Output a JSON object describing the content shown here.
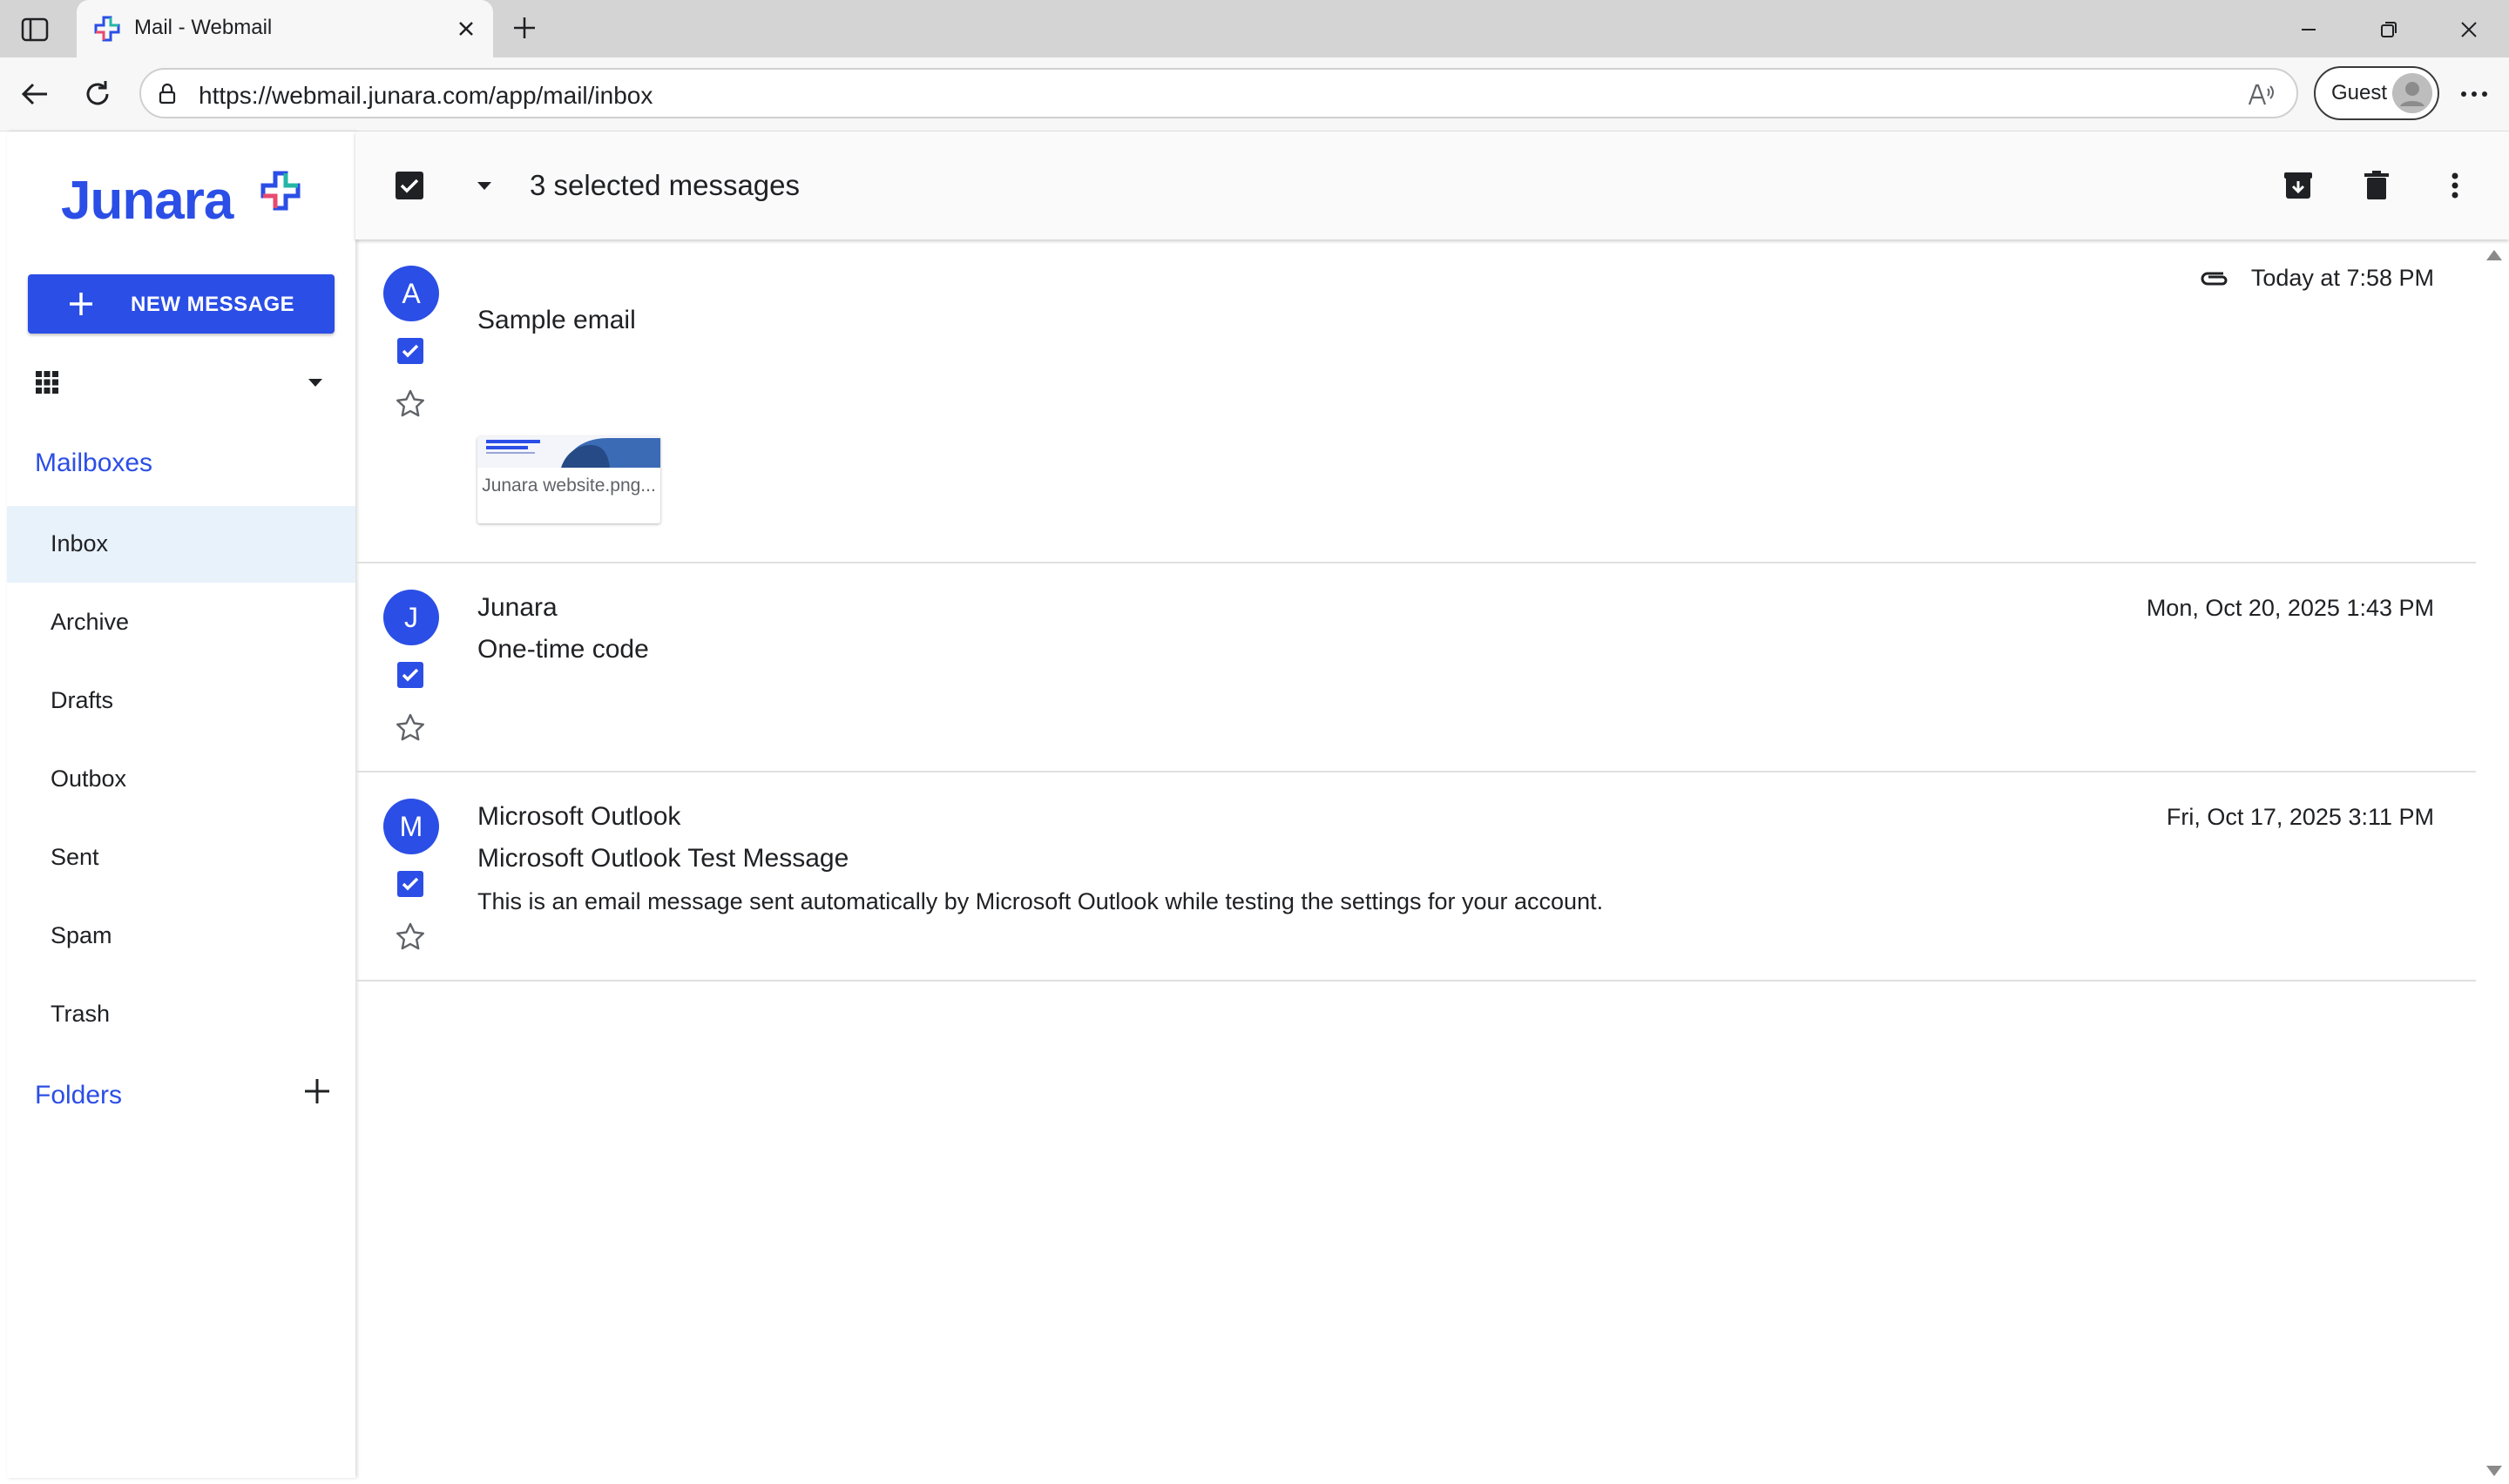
{
  "browser": {
    "tab_title": "Mail - Webmail",
    "url": "https://webmail.junara.com/app/mail/inbox",
    "profile_label": "Guest"
  },
  "app": {
    "logo_text": "Junara",
    "new_message_label": "NEW MESSAGE",
    "mailboxes_title": "Mailboxes",
    "mailboxes": [
      {
        "label": "Inbox",
        "active": true
      },
      {
        "label": "Archive"
      },
      {
        "label": "Drafts"
      },
      {
        "label": "Outbox"
      },
      {
        "label": "Sent"
      },
      {
        "label": "Spam"
      },
      {
        "label": "Trash"
      }
    ],
    "folders_title": "Folders",
    "accent_color": "#2b4ee6"
  },
  "toolbar": {
    "selection_title": "3 selected messages",
    "icons": [
      "checkbox-icon",
      "caret-down-icon",
      "archive-icon",
      "trash-icon",
      "more-vert-icon"
    ]
  },
  "messages": [
    {
      "avatar_letter": "A",
      "sender": "",
      "subject": "Sample email",
      "preview": "",
      "date": "Today at 7:58 PM",
      "has_attachment": true,
      "attachment_name": "Junara website.png...",
      "selected": true,
      "starred": false
    },
    {
      "avatar_letter": "J",
      "sender": "Junara",
      "subject": "One-time code",
      "preview": "",
      "date": "Mon, Oct 20, 2025 1:43 PM",
      "has_attachment": false,
      "selected": true,
      "starred": false
    },
    {
      "avatar_letter": "M",
      "sender": "Microsoft Outlook",
      "subject": "Microsoft Outlook Test Message",
      "preview": "This is an email message sent automatically by Microsoft Outlook while testing the settings for your account.",
      "date": "Fri, Oct 17, 2025 3:11 PM",
      "has_attachment": false,
      "selected": true,
      "starred": false
    }
  ]
}
